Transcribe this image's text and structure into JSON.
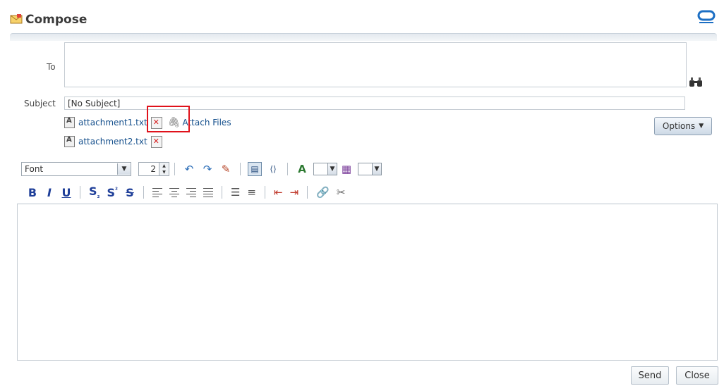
{
  "header": {
    "title": "Compose"
  },
  "form": {
    "to_label": "To",
    "to_value": "",
    "subject_label": "Subject",
    "subject_value": "[No Subject]"
  },
  "attachments": [
    {
      "name": "attachment1.txt"
    },
    {
      "name": "attachment2.txt"
    }
  ],
  "attach_files_label": "Attach Files",
  "options_label": "Options",
  "toolbar": {
    "font_value": "Font",
    "font_size_value": "2"
  },
  "format_buttons": {
    "bold": "B",
    "italic": "I",
    "underline": "U",
    "subscript": "S",
    "superscript": "S",
    "strikethrough": "S"
  },
  "footer": {
    "send_label": "Send",
    "close_label": "Close"
  },
  "colors": {
    "link": "#144f8c",
    "brand": "#1c6fc4",
    "highlight": "#e0121b",
    "bold_icons": "#1f3f99"
  }
}
